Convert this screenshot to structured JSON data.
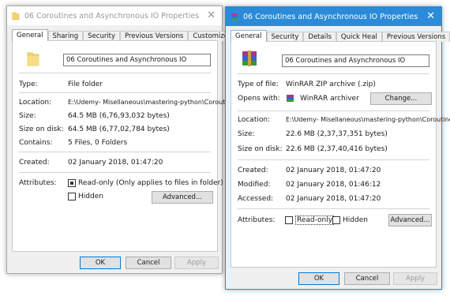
{
  "win1": {
    "title": "06 Coroutines and Asynchronous IO Properties",
    "tabs": [
      "General",
      "Sharing",
      "Security",
      "Previous Versions",
      "Customize"
    ],
    "name": "06 Coroutines and Asynchronous IO",
    "type_label": "Type:",
    "type_value": "File folder",
    "location_label": "Location:",
    "location_value": "E:\\Udemy- Misellaneous\\mastering-python\\Coroutines",
    "size_label": "Size:",
    "size_value": "64.5 MB (6,76,93,032 bytes)",
    "size_disk_label": "Size on disk:",
    "size_disk_value": "64.5 MB (6,77,02,784 bytes)",
    "contains_label": "Contains:",
    "contains_value": "5 Files, 0 Folders",
    "created_label": "Created:",
    "created_value": "02 January 2018, 01:47:20",
    "attributes_label": "Attributes:",
    "readonly_label": "Read-only (Only applies to files in folder)",
    "hidden_label": "Hidden",
    "advanced_label": "Advanced...",
    "ok": "OK",
    "cancel": "Cancel",
    "apply": "Apply"
  },
  "win2": {
    "title": "06 Coroutines and Asynchronous IO Properties",
    "tabs": [
      "General",
      "Security",
      "Details",
      "Quick Heal",
      "Previous Versions"
    ],
    "name": "06 Coroutines and Asynchronous IO",
    "type_label": "Type of file:",
    "type_value": "WinRAR ZIP archive (.zip)",
    "opens_label": "Opens with:",
    "opens_value": "WinRAR archiver",
    "change_label": "Change...",
    "location_label": "Location:",
    "location_value": "E:\\Udemy- Misellaneous\\mastering-python\\Coroutines",
    "size_label": "Size:",
    "size_value": "22.6 MB (2,37,37,351 bytes)",
    "size_disk_label": "Size on disk:",
    "size_disk_value": "22.6 MB (2,37,40,416 bytes)",
    "created_label": "Created:",
    "created_value": "02 January 2018, 01:47:20",
    "modified_label": "Modified:",
    "modified_value": "02 January 2018, 01:46:12",
    "accessed_label": "Accessed:",
    "accessed_value": "02 January 2018, 01:47:20",
    "attributes_label": "Attributes:",
    "readonly_label": "Read-only",
    "hidden_label": "Hidden",
    "advanced_label": "Advanced...",
    "ok": "OK",
    "cancel": "Cancel",
    "apply": "Apply"
  },
  "colors": {
    "titlebar_active": "#2b8bd8",
    "folder": "#f5d36b"
  },
  "icons": {
    "folder": "folder-icon",
    "winrar": "winrar-icon",
    "close": "close-icon"
  }
}
